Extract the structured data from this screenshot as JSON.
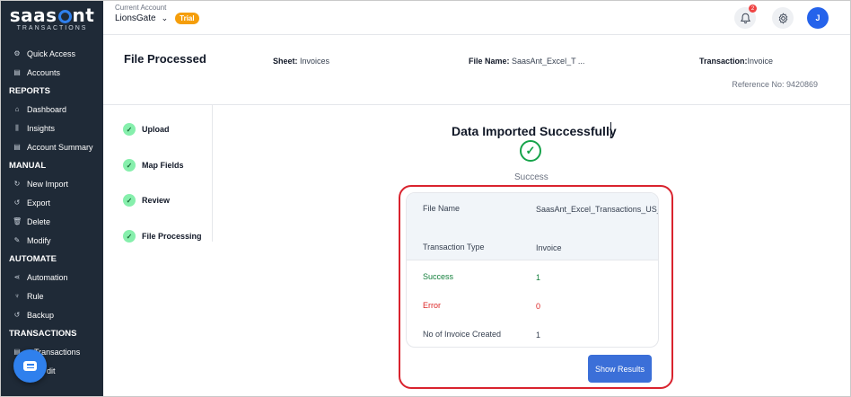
{
  "brand": {
    "name_left": "saas",
    "name_right": "nt",
    "tagline": "TRANSACTIONS",
    "accent": "#2f80ed"
  },
  "account": {
    "label": "Current Account",
    "name": "LionsGate",
    "trial_badge": "Trial"
  },
  "notifications": {
    "count": "2"
  },
  "user": {
    "initial": "J"
  },
  "sidebar": {
    "items": [
      {
        "label": "Quick Access",
        "icon": "gear-icon",
        "type": "item"
      },
      {
        "label": "Accounts",
        "icon": "clipboard-icon",
        "type": "item"
      },
      {
        "label": "REPORTS",
        "type": "heading"
      },
      {
        "label": "Dashboard",
        "icon": "home-icon",
        "type": "item"
      },
      {
        "label": "Insights",
        "icon": "bars-icon",
        "type": "item"
      },
      {
        "label": "Account Summary",
        "icon": "clipboard-icon",
        "type": "item"
      },
      {
        "label": "MANUAL",
        "type": "heading"
      },
      {
        "label": "New Import",
        "icon": "import-icon",
        "type": "item"
      },
      {
        "label": "Export",
        "icon": "export-icon",
        "type": "item"
      },
      {
        "label": "Delete",
        "icon": "trash-icon",
        "type": "item"
      },
      {
        "label": "Modify",
        "icon": "edit-icon",
        "type": "item"
      },
      {
        "label": "AUTOMATE",
        "type": "heading"
      },
      {
        "label": "Automation",
        "icon": "share-icon",
        "type": "item"
      },
      {
        "label": "Rule",
        "icon": "rule-icon",
        "type": "item"
      },
      {
        "label": "Backup",
        "icon": "backup-icon",
        "type": "item"
      },
      {
        "label": "TRANSACTIONS",
        "type": "heading"
      },
      {
        "label": "Transactions",
        "icon": "list-icon",
        "type": "item"
      },
      {
        "label": "dit",
        "icon": "edit-icon",
        "type": "item"
      }
    ]
  },
  "header": {
    "title": "File Processed",
    "sheet_label": "Sheet:",
    "sheet_value": "Invoices",
    "file_label": "File Name:",
    "file_value": "SaasAnt_Excel_T ...",
    "txn_label": "Transaction:",
    "txn_value": "Invoice",
    "reference": "Reference No: 9420869"
  },
  "steps": [
    {
      "label": "Upload"
    },
    {
      "label": "Map Fields"
    },
    {
      "label": "Review"
    },
    {
      "label": "File Processing"
    }
  ],
  "result": {
    "title": "Data Imported Successfully",
    "status": "Success",
    "rows": [
      {
        "label": "File Name",
        "value": "SaasAnt_Excel_Transactions_US_Template.xlsx"
      },
      {
        "label": "Transaction Type",
        "value": "Invoice"
      },
      {
        "label": "Success",
        "value": "1"
      },
      {
        "label": "Error",
        "value": "0"
      },
      {
        "label": "No of Invoice Created",
        "value": "1"
      }
    ],
    "button": "Show Results"
  }
}
